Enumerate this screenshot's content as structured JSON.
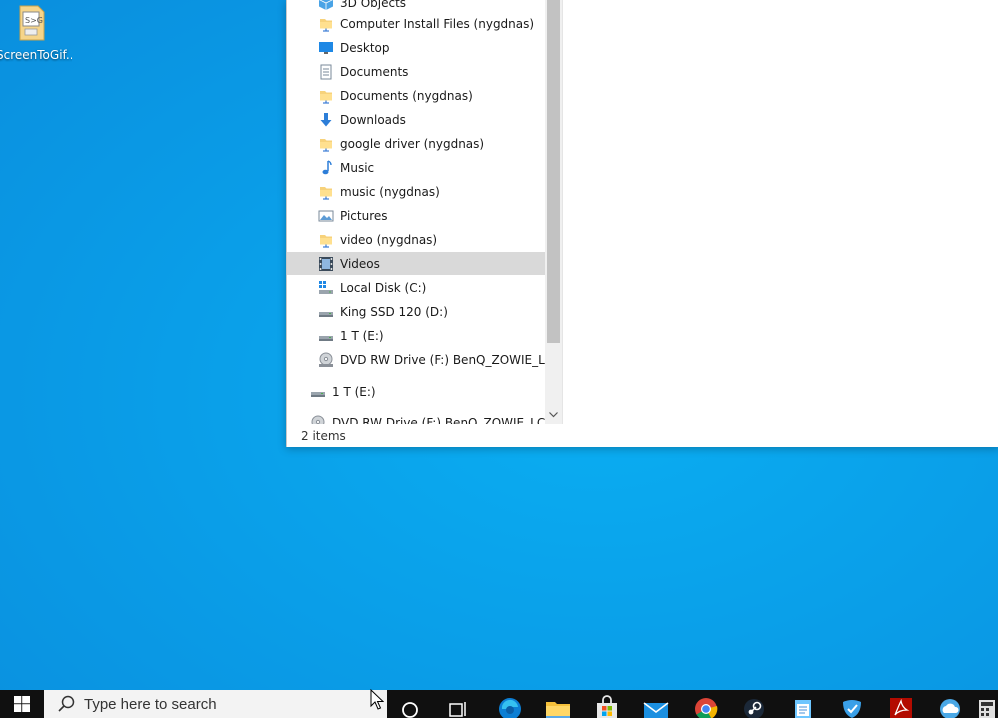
{
  "desktop": {
    "icon_label": "ScreenToGif..."
  },
  "explorer": {
    "nav_items": [
      {
        "label": "3D Objects",
        "icon": "cube-icon"
      },
      {
        "label": "Computer Install Files (nygdnas)",
        "icon": "network-folder-icon"
      },
      {
        "label": "Desktop",
        "icon": "desktop-icon"
      },
      {
        "label": "Documents",
        "icon": "documents-icon"
      },
      {
        "label": "Documents (nygdnas)",
        "icon": "network-folder-icon"
      },
      {
        "label": "Downloads",
        "icon": "download-arrow-icon"
      },
      {
        "label": "google driver (nygdnas)",
        "icon": "network-folder-icon"
      },
      {
        "label": "Music",
        "icon": "music-note-icon"
      },
      {
        "label": "music (nygdnas)",
        "icon": "network-folder-icon"
      },
      {
        "label": "Pictures",
        "icon": "pictures-icon"
      },
      {
        "label": "video (nygdnas)",
        "icon": "network-folder-icon"
      },
      {
        "label": "Videos",
        "icon": "film-icon"
      },
      {
        "label": "Local Disk (C:)",
        "icon": "windows-drive-icon"
      },
      {
        "label": "King SSD 120 (D:)",
        "icon": "drive-icon"
      },
      {
        "label": "1 T (E:)",
        "icon": "drive-icon"
      },
      {
        "label": "DVD RW Drive (F:) BenQ_ZOWIE_LCD",
        "icon": "dvd-icon"
      },
      {
        "label": "1 T (E:)",
        "icon": "drive-icon"
      },
      {
        "label": "DVD RW Drive (F:) BenQ_ZOWIE_LCD",
        "icon": "dvd-icon"
      }
    ],
    "selected_item": "Videos",
    "status_text": "2 items"
  },
  "taskbar": {
    "search_placeholder": "Type here to search",
    "apps": [
      "cortana-icon",
      "task-view-icon",
      "edge-icon",
      "file-explorer-icon",
      "store-icon",
      "mail-icon",
      "chrome-icon",
      "steam-icon",
      "notepad-icon",
      "shield-app-icon",
      "acrobat-icon",
      "cloud-app-icon",
      "calculator-icon"
    ]
  },
  "colors": {
    "desktop_bg": "#0a9be6",
    "selection": "#d9d9d9",
    "taskbar": "#101010"
  }
}
